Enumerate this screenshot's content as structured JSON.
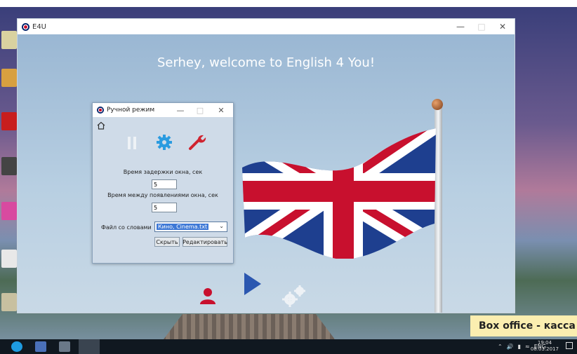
{
  "main_window": {
    "title": "E4U",
    "welcome": "Serhey, welcome to English 4 You!"
  },
  "dialog": {
    "title": "Ручной режим",
    "delay_label": "Время задержки окна, сек",
    "delay_value": "5",
    "interval_label": "Время между появлениями окна, сек",
    "interval_value": "5",
    "file_label": "Файл со словами",
    "file_value": "Кино, Cinema.txt",
    "hide_button": "Скрыть",
    "edit_button": "Редактировать"
  },
  "overlay": {
    "caption": "Box office - касса"
  },
  "taskbar": {
    "language": "ENG",
    "time": "19:04",
    "date": "08.03.2017"
  },
  "colors": {
    "accent_blue": "#2b57b0",
    "gear_blue": "#2a9be0",
    "wrench_red": "#d0232f",
    "person_red": "#c8102e"
  }
}
